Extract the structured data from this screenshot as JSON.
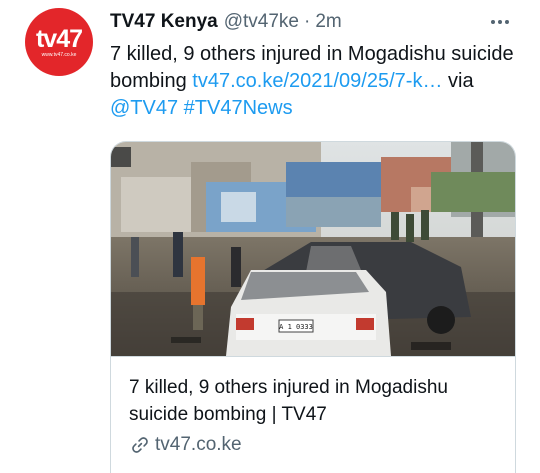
{
  "tweet": {
    "avatar": {
      "logo_text": "tv47",
      "logo_url": "www.tv47.co.ke"
    },
    "display_name": "TV47 Kenya",
    "handle": "@tv47ke",
    "separator": "·",
    "time": "2m",
    "more_icon": "more-horizontal-icon",
    "text": {
      "main": "7 killed, 9 others injured in Mogadishu suicide bombing ",
      "url": "tv47.co.ke/2021/09/25/7-k…",
      "via": " via ",
      "mention": "@TV47",
      "space": " ",
      "hashtag": "#TV47News"
    },
    "card": {
      "title": "7 killed, 9 others injured in Mogadishu suicide bombing | TV47",
      "domain": "tv47.co.ke",
      "link_icon": "link-icon",
      "image_plate": "A 1 0333"
    },
    "colors": {
      "brand": "#e3262a",
      "link": "#1d9bf0",
      "muted": "#536471",
      "border": "#cfd9de"
    }
  }
}
